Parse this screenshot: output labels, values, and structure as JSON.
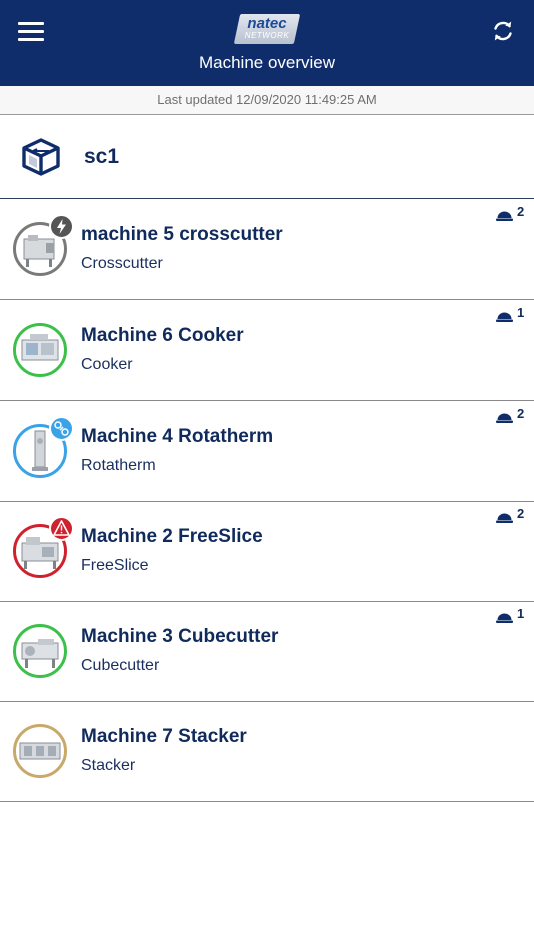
{
  "header": {
    "title": "Machine overview",
    "logo_main": "natec",
    "logo_sub": "NETWORK",
    "menu_icon": "hamburger-menu-icon",
    "refresh_icon": "refresh-icon",
    "background_color": "#0f2d6b"
  },
  "last_updated": "Last updated 12/09/2020 11:49:25 AM",
  "site": {
    "name": "sc1",
    "icon": "site-cube-icon"
  },
  "colors": {
    "offline": "#7a7a7a",
    "running": "#3cc04a",
    "maintenance": "#3aa3e8",
    "error": "#d0212f",
    "idle": "#c8a96a",
    "text_dark": "#102a5c"
  },
  "machines": [
    {
      "name": "machine 5 crosscutter",
      "type": "Crosscutter",
      "status": "offline",
      "badge": "lightning-icon",
      "operators": "2"
    },
    {
      "name": "Machine 6 Cooker",
      "type": "Cooker",
      "status": "running",
      "badge": "",
      "operators": "1"
    },
    {
      "name": "Machine 4 Rotatherm",
      "type": "Rotatherm",
      "status": "maintenance",
      "badge": "maintenance-icon",
      "operators": "2"
    },
    {
      "name": "Machine 2 FreeSlice",
      "type": "FreeSlice",
      "status": "error",
      "badge": "warning-icon",
      "operators": "2"
    },
    {
      "name": "Machine 3 Cubecutter",
      "type": "Cubecutter",
      "status": "running",
      "badge": "",
      "operators": "1"
    },
    {
      "name": "Machine 7 Stacker",
      "type": "Stacker",
      "status": "idle",
      "badge": "",
      "operators": ""
    }
  ]
}
